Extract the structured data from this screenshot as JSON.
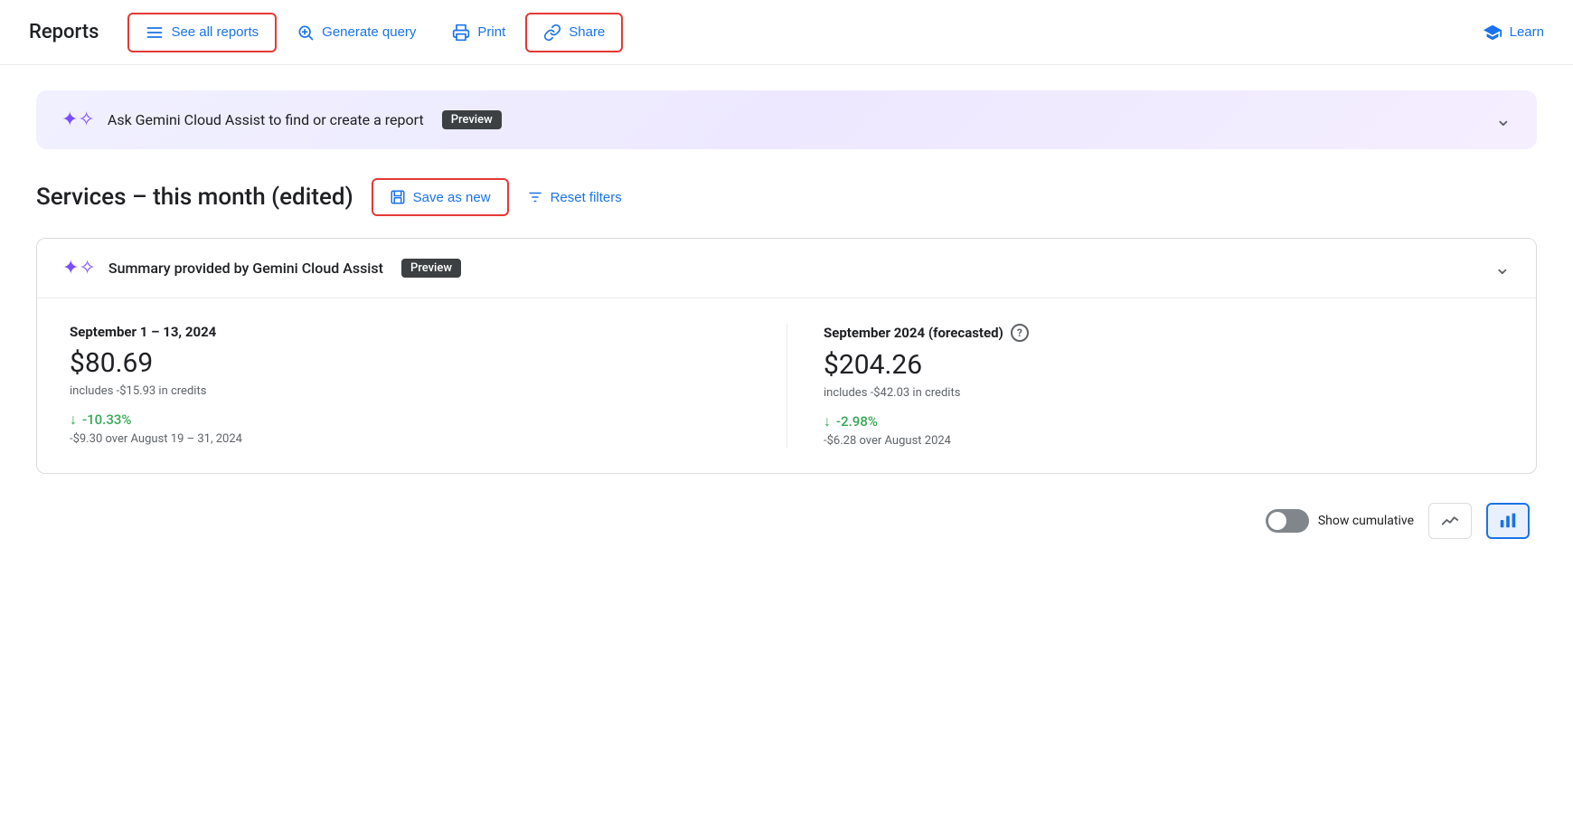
{
  "header": {
    "title": "Reports",
    "nav": {
      "see_all_reports": "See all reports",
      "generate_query": "Generate query",
      "print": "Print",
      "share": "Share"
    },
    "learn": "Learn"
  },
  "gemini_banner": {
    "text": "Ask Gemini Cloud Assist to find or create a report",
    "badge": "Preview"
  },
  "report": {
    "title": "Services – this month (edited)",
    "save_as_new": "Save as new",
    "reset_filters": "Reset filters"
  },
  "summary_card": {
    "header": "Summary provided by Gemini Cloud Assist",
    "badge": "Preview",
    "left_period": "September 1 – 13, 2024",
    "left_amount": "$80.69",
    "left_credits": "includes -$15.93 in credits",
    "left_change": "-10.33%",
    "left_change_desc": "-$9.30 over August 19 – 31, 2024",
    "right_period": "September 2024 (forecasted)",
    "right_amount": "$204.26",
    "right_credits": "includes -$42.03 in credits",
    "right_change": "-2.98%",
    "right_change_desc": "-$6.28 over August 2024"
  },
  "bottom_bar": {
    "show_cumulative": "Show cumulative"
  }
}
